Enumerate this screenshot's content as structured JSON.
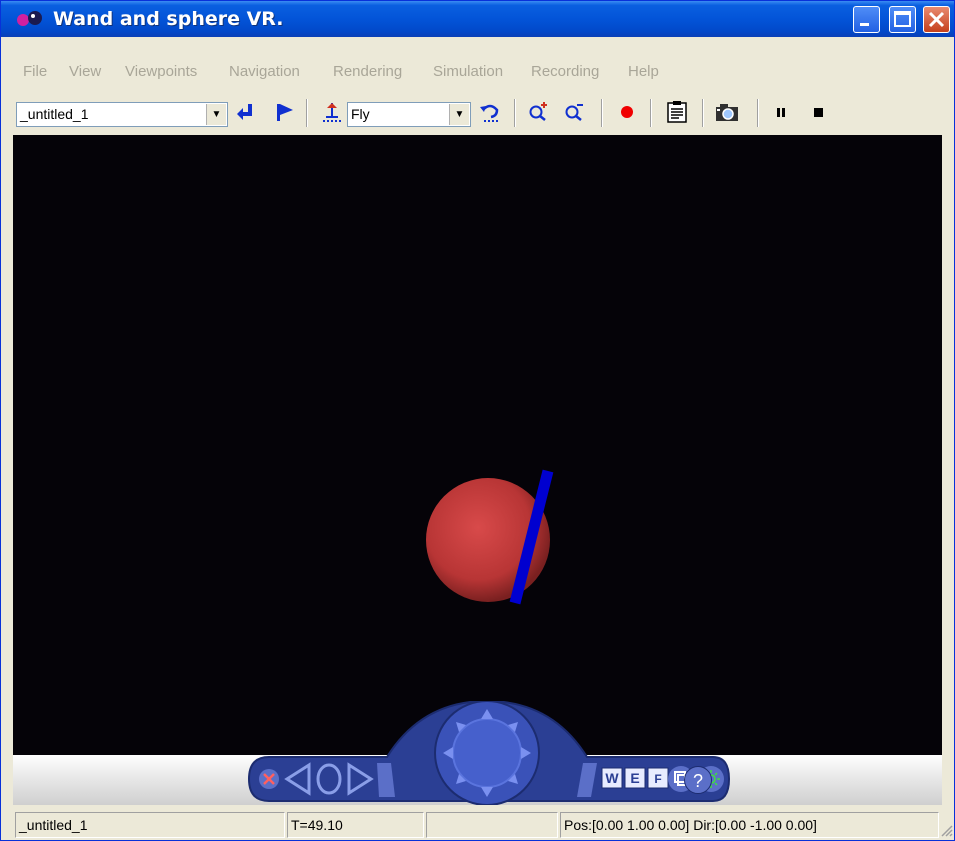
{
  "window": {
    "title": "Wand and sphere VR."
  },
  "menu": [
    "File",
    "View",
    "Viewpoints",
    "Navigation",
    "Rendering",
    "Simulation",
    "Recording",
    "Help"
  ],
  "toolbar": {
    "world_select": "_untitled_1",
    "nav_mode": "Fly",
    "icons": [
      "return-icon",
      "flag-icon",
      "straighten-icon",
      "undo-move-icon",
      "zoom-in-icon",
      "zoom-out-icon",
      "record-icon",
      "clipboard-icon",
      "camera-icon",
      "pause-icon",
      "stop-icon"
    ]
  },
  "scene": {
    "background": "#050308",
    "sphere_color": "#c84040",
    "wand_color": "#0000d0"
  },
  "navpanel": {
    "buttons": [
      "W",
      "E",
      "F"
    ],
    "help": "?"
  },
  "status": {
    "world": "_untitled_1",
    "time": "T=49.10",
    "blank": "",
    "pose": "Pos:[0.00 1.00 0.00] Dir:[0.00 -1.00 0.00]"
  }
}
